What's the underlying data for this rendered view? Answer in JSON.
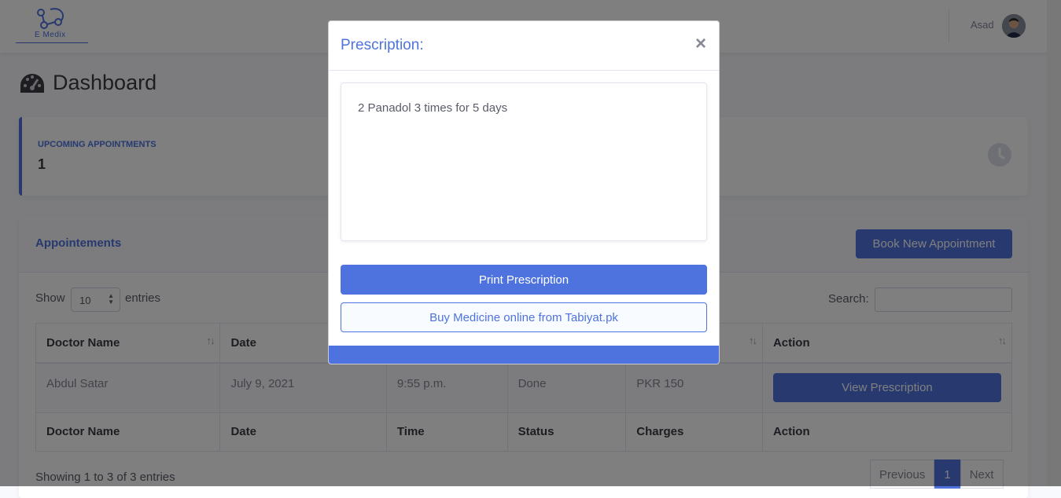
{
  "header": {
    "logo_text": "E Medix",
    "user_name": "Asad"
  },
  "page": {
    "title": "Dashboard"
  },
  "stats": {
    "upcoming_label": "UPCOMING APPOINTMENTS",
    "upcoming_value": "1"
  },
  "appointments": {
    "title": "Appointements",
    "book_button": "Book New Appointment",
    "show_label": "Show",
    "page_length": "10",
    "entries_label": "entries",
    "search_label": "Search:",
    "columns": [
      "Doctor Name",
      "Date",
      "Time",
      "Status",
      "Charges",
      "Action"
    ],
    "rows": [
      {
        "doctor": "Abdul Satar",
        "date": "July 9, 2021",
        "time": "9:55 p.m.",
        "status": "Done",
        "charges": "PKR 150",
        "action": "View Prescription"
      }
    ],
    "info": "Showing 1 to 3 of 3 entries",
    "pagination": {
      "previous": "Previous",
      "current": "1",
      "next": "Next"
    }
  },
  "modal": {
    "title": "Prescription:",
    "close": "×",
    "prescription": "2 Panadol 3 times for 5 days",
    "print_button": "Print Prescription",
    "buy_button": "Buy Medicine online from Tabiyat.pk"
  }
}
